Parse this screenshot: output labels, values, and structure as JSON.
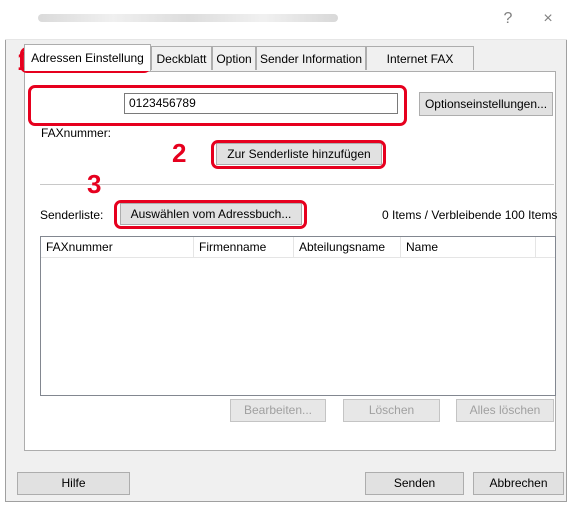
{
  "titlebar": {
    "help_glyph": "?",
    "close_glyph": "×"
  },
  "callouts": {
    "one": "1",
    "two": "2",
    "three": "3"
  },
  "tabs": [
    {
      "label": "Adressen Einstellung",
      "active": true
    },
    {
      "label": "Deckblatt"
    },
    {
      "label": "Option"
    },
    {
      "label": "Sender Information"
    },
    {
      "label": "Internet FAX"
    }
  ],
  "fax": {
    "label": "FAXnummer:",
    "value": "0123456789",
    "options_button": "Optionseinstellungen..."
  },
  "add_button": "Zur Senderliste hinzufügen",
  "sender": {
    "label": "Senderliste:",
    "addressbook_button": "Auswählen vom Adressbuch...",
    "count": "0 Items / Verbleibende 100 Items"
  },
  "table": {
    "columns": [
      "FAXnummer",
      "Firmenname",
      "Abteilungsname",
      "Name"
    ],
    "rows": []
  },
  "list_buttons": {
    "edit": "Bearbeiten...",
    "delete": "Löschen",
    "delete_all": "Alles löschen"
  },
  "footer": {
    "help": "Hilfe",
    "send": "Senden",
    "cancel": "Abbrechen"
  },
  "colors": {
    "accent_red": "#e6001e",
    "window_bg": "#f0f0f0"
  }
}
